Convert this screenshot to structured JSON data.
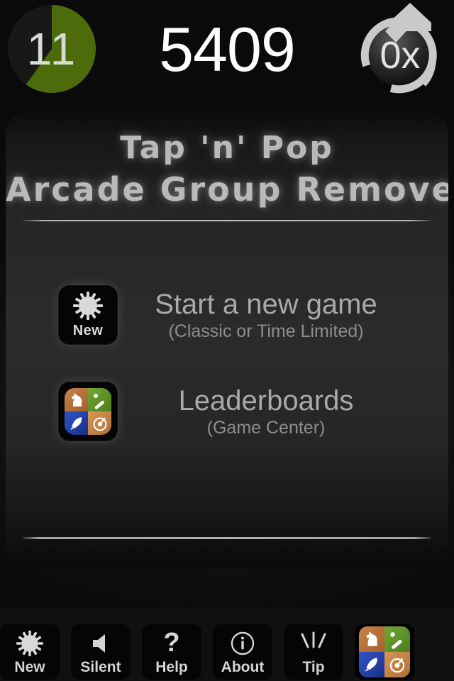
{
  "hud": {
    "level_value": "11",
    "level_progress_percent": 60,
    "level_fill_color": "#4d6b0a",
    "level_track_color": "#181818",
    "score": "5409",
    "combo": "0x",
    "combo_icon": "circular-arrow-icon"
  },
  "panel": {
    "title_line1": "Tap 'n' Pop",
    "title_line2": "Arcade Group Remove",
    "menu": [
      {
        "icon": "starburst-new-icon",
        "icon_caption": "New",
        "title": "Start a new game",
        "subtitle": "(Classic or Time Limited)"
      },
      {
        "icon": "game-center-icon",
        "icon_caption": "",
        "title": "Leaderboards",
        "subtitle": "(Game Center)"
      }
    ]
  },
  "toolbar": {
    "buttons": [
      {
        "label": "New",
        "icon": "starburst-icon"
      },
      {
        "label": "Silent",
        "icon": "speaker-muted-icon"
      },
      {
        "label": "Help",
        "icon": "question-mark-icon"
      },
      {
        "label": "About",
        "icon": "info-circle-icon"
      },
      {
        "label": "Tip",
        "icon": "idea-rays-icon"
      },
      {
        "label": "",
        "icon": "game-center-icon"
      }
    ]
  },
  "colors": {
    "accent_green": "#4d6b0a",
    "text_primary": "#fdfdfd",
    "text_muted": "#a9a9a9",
    "panel_bg": "#2b2b2b"
  }
}
